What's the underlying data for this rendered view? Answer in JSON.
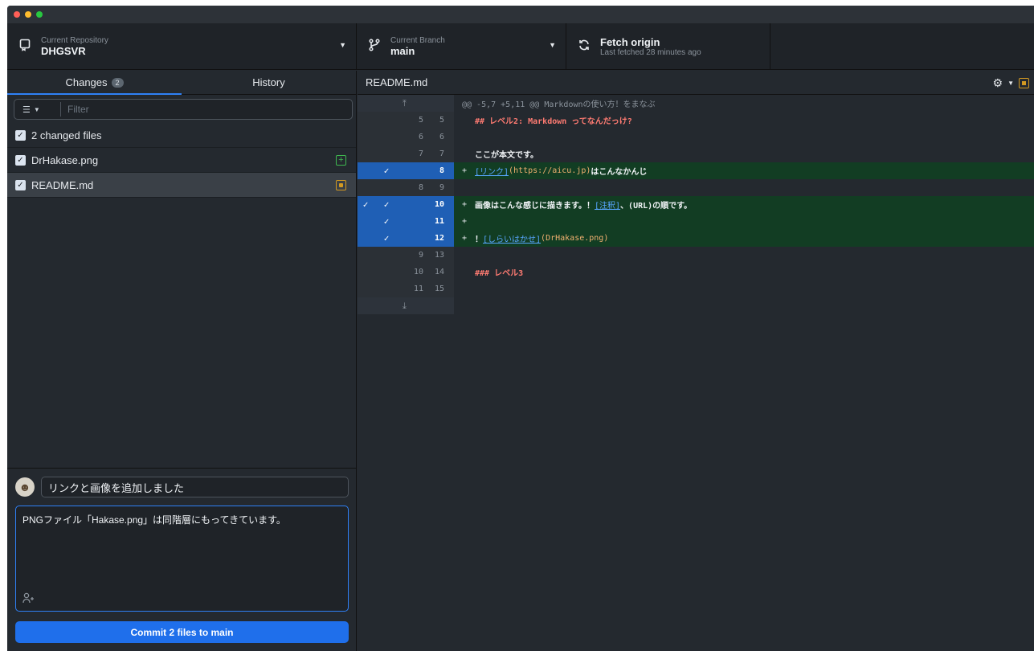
{
  "toolbar": {
    "repo_label": "Current Repository",
    "repo_name": "DHGSVR",
    "branch_label": "Current Branch",
    "branch_name": "main",
    "fetch_title": "Fetch origin",
    "fetch_sub": "Last fetched 28 minutes ago"
  },
  "tabs": {
    "changes_label": "Changes",
    "changes_count": "2",
    "history_label": "History"
  },
  "filter": {
    "placeholder": "Filter"
  },
  "files": {
    "summary": "2 changed files",
    "items": [
      {
        "name": "DrHakase.png",
        "status": "added"
      },
      {
        "name": "README.md",
        "status": "modified"
      }
    ]
  },
  "commit": {
    "summary": "リンクと画像を追加しました",
    "description": "PNGファイル「Hakase.png」は同階層にもってきています。",
    "button_prefix": "Commit 2 files to ",
    "button_branch": "main"
  },
  "diff": {
    "file_name": "README.md",
    "hunk_header": "@@ -5,7 +5,11 @@ Markdownの使い方！をまなぶ",
    "lines": [
      {
        "old": "5",
        "new": "5",
        "marker": "",
        "head": "## レベル2: Markdown ってなんだっけ?"
      },
      {
        "old": "6",
        "new": "6",
        "marker": "",
        "text": ""
      },
      {
        "old": "7",
        "new": "7",
        "marker": "",
        "text": "ここが本文です。"
      },
      {
        "old": "",
        "new": "8",
        "marker": "+",
        "link": "[リンク]",
        "url": "(https://aicu.jp)",
        "text": "はこんなかんじ"
      },
      {
        "old": "8",
        "new": "9",
        "marker": "",
        "text": ""
      },
      {
        "old": "",
        "new": "10",
        "marker": "+",
        "text": "画像はこんな感じに描きます。！",
        "link": "[注釈]",
        "text2": "、(URL)の順です。"
      },
      {
        "old": "",
        "new": "11",
        "marker": "+",
        "text": ""
      },
      {
        "old": "",
        "new": "12",
        "marker": "+",
        "text": "！",
        "link": "[しらいはかせ]",
        "url": "(DrHakase.png)"
      },
      {
        "old": "9",
        "new": "13",
        "marker": "",
        "text": ""
      },
      {
        "old": "10",
        "new": "14",
        "marker": "",
        "head": "### レベル3"
      },
      {
        "old": "11",
        "new": "15",
        "marker": "",
        "text": ""
      }
    ]
  },
  "icons": {
    "repo": "repo-icon",
    "branch": "branch-icon",
    "fetch": "sync-icon",
    "settings": "gear-icon",
    "coauthor": "person-add-icon"
  },
  "colors": {
    "accent": "#1f6feb",
    "added": "#3fb950",
    "modified": "#d29922"
  }
}
